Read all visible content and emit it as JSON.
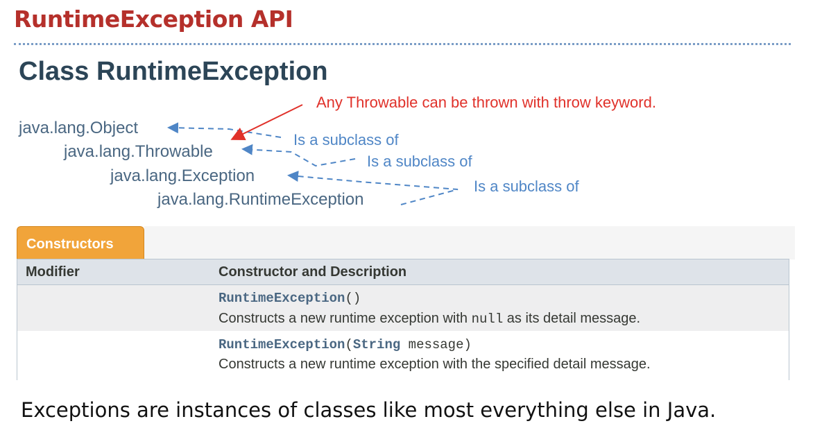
{
  "slide": {
    "title": "RuntimeException API",
    "footer": "Exceptions are instances of classes like most everything else in Java."
  },
  "doc": {
    "heading": "Class RuntimeException",
    "hierarchy": [
      "java.lang.Object",
      "java.lang.Throwable",
      "java.lang.Exception",
      "java.lang.RuntimeException"
    ],
    "callout": "Any Throwable can be thrown with throw keyword.",
    "subclass_labels": [
      "Is a subclass of",
      "Is a subclass of",
      "Is a subclass of"
    ],
    "constructors": {
      "tab_label": "Constructors",
      "columns": [
        "Modifier",
        "Constructor and Description"
      ],
      "rows": [
        {
          "name": "RuntimeException",
          "params": "()",
          "desc_pre": "Constructs a new runtime exception with ",
          "desc_code": "null",
          "desc_post": " as its detail message."
        },
        {
          "name": "RuntimeException",
          "params_open": "(",
          "param_type": "String",
          "params_rest": " message)",
          "desc": "Constructs a new runtime exception with the specified detail message."
        }
      ]
    }
  },
  "colors": {
    "title_red": "#b5302b",
    "callout_red": "#e0312a",
    "arrow_blue": "#4f86c6",
    "tab_orange": "#f1a43a"
  }
}
